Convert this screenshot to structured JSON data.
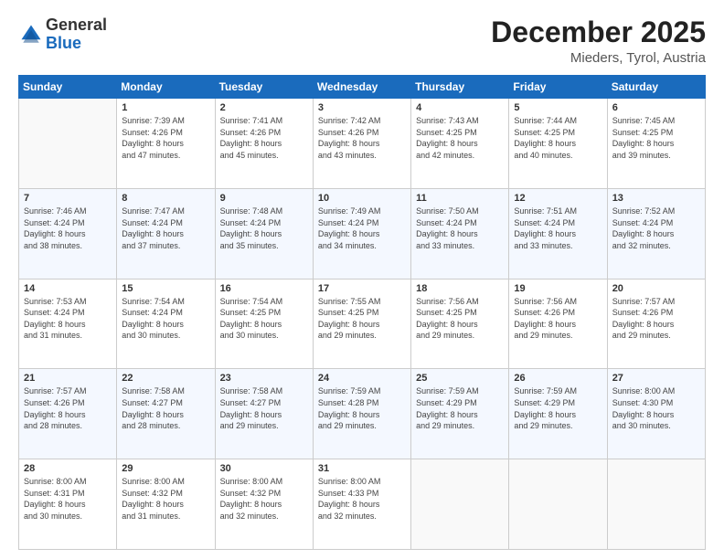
{
  "header": {
    "logo_general": "General",
    "logo_blue": "Blue",
    "month_title": "December 2025",
    "location": "Mieders, Tyrol, Austria"
  },
  "weekdays": [
    "Sunday",
    "Monday",
    "Tuesday",
    "Wednesday",
    "Thursday",
    "Friday",
    "Saturday"
  ],
  "weeks": [
    [
      {
        "day": "",
        "info": ""
      },
      {
        "day": "1",
        "info": "Sunrise: 7:39 AM\nSunset: 4:26 PM\nDaylight: 8 hours\nand 47 minutes."
      },
      {
        "day": "2",
        "info": "Sunrise: 7:41 AM\nSunset: 4:26 PM\nDaylight: 8 hours\nand 45 minutes."
      },
      {
        "day": "3",
        "info": "Sunrise: 7:42 AM\nSunset: 4:26 PM\nDaylight: 8 hours\nand 43 minutes."
      },
      {
        "day": "4",
        "info": "Sunrise: 7:43 AM\nSunset: 4:25 PM\nDaylight: 8 hours\nand 42 minutes."
      },
      {
        "day": "5",
        "info": "Sunrise: 7:44 AM\nSunset: 4:25 PM\nDaylight: 8 hours\nand 40 minutes."
      },
      {
        "day": "6",
        "info": "Sunrise: 7:45 AM\nSunset: 4:25 PM\nDaylight: 8 hours\nand 39 minutes."
      }
    ],
    [
      {
        "day": "7",
        "info": "Sunrise: 7:46 AM\nSunset: 4:24 PM\nDaylight: 8 hours\nand 38 minutes."
      },
      {
        "day": "8",
        "info": "Sunrise: 7:47 AM\nSunset: 4:24 PM\nDaylight: 8 hours\nand 37 minutes."
      },
      {
        "day": "9",
        "info": "Sunrise: 7:48 AM\nSunset: 4:24 PM\nDaylight: 8 hours\nand 35 minutes."
      },
      {
        "day": "10",
        "info": "Sunrise: 7:49 AM\nSunset: 4:24 PM\nDaylight: 8 hours\nand 34 minutes."
      },
      {
        "day": "11",
        "info": "Sunrise: 7:50 AM\nSunset: 4:24 PM\nDaylight: 8 hours\nand 33 minutes."
      },
      {
        "day": "12",
        "info": "Sunrise: 7:51 AM\nSunset: 4:24 PM\nDaylight: 8 hours\nand 33 minutes."
      },
      {
        "day": "13",
        "info": "Sunrise: 7:52 AM\nSunset: 4:24 PM\nDaylight: 8 hours\nand 32 minutes."
      }
    ],
    [
      {
        "day": "14",
        "info": "Sunrise: 7:53 AM\nSunset: 4:24 PM\nDaylight: 8 hours\nand 31 minutes."
      },
      {
        "day": "15",
        "info": "Sunrise: 7:54 AM\nSunset: 4:24 PM\nDaylight: 8 hours\nand 30 minutes."
      },
      {
        "day": "16",
        "info": "Sunrise: 7:54 AM\nSunset: 4:25 PM\nDaylight: 8 hours\nand 30 minutes."
      },
      {
        "day": "17",
        "info": "Sunrise: 7:55 AM\nSunset: 4:25 PM\nDaylight: 8 hours\nand 29 minutes."
      },
      {
        "day": "18",
        "info": "Sunrise: 7:56 AM\nSunset: 4:25 PM\nDaylight: 8 hours\nand 29 minutes."
      },
      {
        "day": "19",
        "info": "Sunrise: 7:56 AM\nSunset: 4:26 PM\nDaylight: 8 hours\nand 29 minutes."
      },
      {
        "day": "20",
        "info": "Sunrise: 7:57 AM\nSunset: 4:26 PM\nDaylight: 8 hours\nand 29 minutes."
      }
    ],
    [
      {
        "day": "21",
        "info": "Sunrise: 7:57 AM\nSunset: 4:26 PM\nDaylight: 8 hours\nand 28 minutes."
      },
      {
        "day": "22",
        "info": "Sunrise: 7:58 AM\nSunset: 4:27 PM\nDaylight: 8 hours\nand 28 minutes."
      },
      {
        "day": "23",
        "info": "Sunrise: 7:58 AM\nSunset: 4:27 PM\nDaylight: 8 hours\nand 29 minutes."
      },
      {
        "day": "24",
        "info": "Sunrise: 7:59 AM\nSunset: 4:28 PM\nDaylight: 8 hours\nand 29 minutes."
      },
      {
        "day": "25",
        "info": "Sunrise: 7:59 AM\nSunset: 4:29 PM\nDaylight: 8 hours\nand 29 minutes."
      },
      {
        "day": "26",
        "info": "Sunrise: 7:59 AM\nSunset: 4:29 PM\nDaylight: 8 hours\nand 29 minutes."
      },
      {
        "day": "27",
        "info": "Sunrise: 8:00 AM\nSunset: 4:30 PM\nDaylight: 8 hours\nand 30 minutes."
      }
    ],
    [
      {
        "day": "28",
        "info": "Sunrise: 8:00 AM\nSunset: 4:31 PM\nDaylight: 8 hours\nand 30 minutes."
      },
      {
        "day": "29",
        "info": "Sunrise: 8:00 AM\nSunset: 4:32 PM\nDaylight: 8 hours\nand 31 minutes."
      },
      {
        "day": "30",
        "info": "Sunrise: 8:00 AM\nSunset: 4:32 PM\nDaylight: 8 hours\nand 32 minutes."
      },
      {
        "day": "31",
        "info": "Sunrise: 8:00 AM\nSunset: 4:33 PM\nDaylight: 8 hours\nand 32 minutes."
      },
      {
        "day": "",
        "info": ""
      },
      {
        "day": "",
        "info": ""
      },
      {
        "day": "",
        "info": ""
      }
    ]
  ]
}
